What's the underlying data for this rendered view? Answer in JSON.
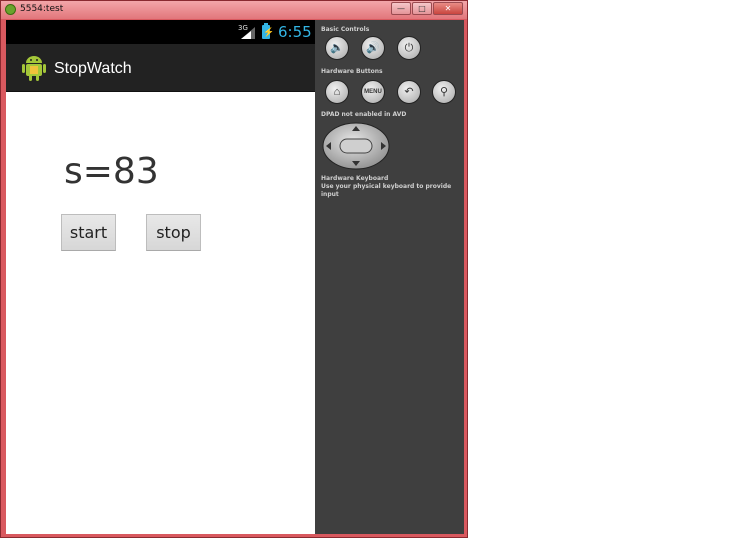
{
  "window": {
    "title": "5554:test",
    "controls": {
      "minimize": "—",
      "maximize": "□",
      "close": "✕"
    }
  },
  "statusbar": {
    "network": "3G",
    "clock": "6:55",
    "battery_icon": "battery-charging-icon",
    "battery_glyph": "⚡"
  },
  "actionbar": {
    "title": "StopWatch",
    "icon": "android-icon"
  },
  "content": {
    "counter": "s=83",
    "start_label": "start",
    "stop_label": "stop"
  },
  "panel": {
    "basic_controls_label": "Basic Controls",
    "hardware_buttons_label": "Hardware Buttons",
    "dpad_label": "DPAD not enabled in AVD",
    "keyboard_title": "Hardware Keyboard",
    "keyboard_hint": "Use your physical keyboard to provide input",
    "menu_label": "MENU",
    "glyphs": {
      "vol_down": "🔈",
      "vol_up": "🔊",
      "power": "⏻",
      "home": "⌂",
      "back": "↶",
      "search": "⚲"
    }
  },
  "colors": {
    "accent": "#33b5e5",
    "frame": "#d9595f",
    "panel": "#3f3f3f"
  }
}
